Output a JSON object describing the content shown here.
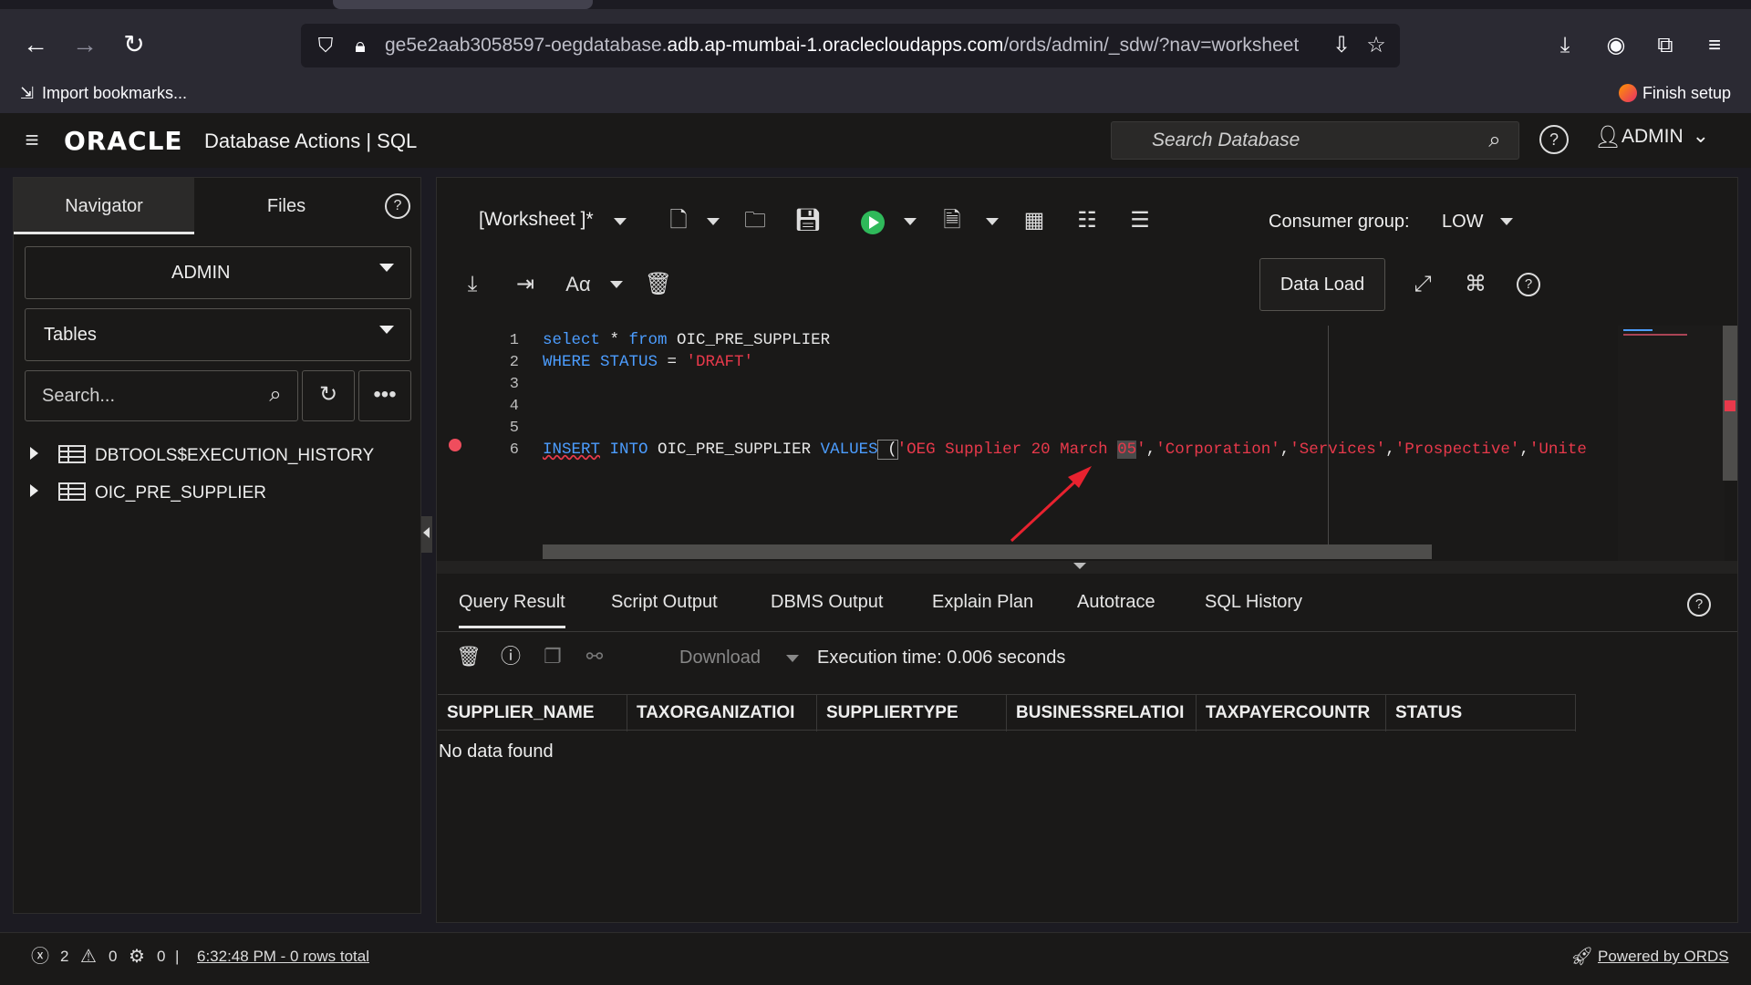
{
  "browser": {
    "url_prefix": "ge5e2aab3058597-oegdatabase.",
    "url_domain": "adb.ap-mumbai-1.oraclecloudapps.com",
    "url_path": "/ords/admin/_sdw/?nav=worksheet",
    "bookmark_import": "Import bookmarks...",
    "finish_setup": "Finish setup"
  },
  "header": {
    "logo": "ORACLE",
    "title": "Database Actions |  SQL",
    "search_placeholder": "Search Database",
    "user": "ADMIN"
  },
  "navigator": {
    "tabs": [
      "Navigator",
      "Files"
    ],
    "schema": "ADMIN",
    "object_type": "Tables",
    "search_placeholder": "Search...",
    "items": [
      {
        "label": "DBTOOLS$EXECUTION_HISTORY"
      },
      {
        "label": "OIC_PRE_SUPPLIER"
      }
    ]
  },
  "worksheet": {
    "name": "[Worksheet ]*",
    "consumer_group_label": "Consumer group:",
    "consumer_group_value": "LOW",
    "data_load_label": "Data Load",
    "line_numbers": [
      "1",
      "2",
      "3",
      "4",
      "5",
      "6"
    ],
    "code": {
      "l1_kw1": "select",
      "l1_mid": " * ",
      "l1_kw2": "from",
      "l1_id": " OIC_PRE_SUPPLIER",
      "l2_kw": "WHERE STATUS",
      "l2_eq": " = ",
      "l2_str": "'DRAFT'",
      "l6_kw1": "INSERT",
      "l6_sp1": " ",
      "l6_kw2": "INTO",
      "l6_id": " OIC_PRE_SUPPLIER ",
      "l6_kw3": "VALUES",
      "l6_paren": " (",
      "l6_s1a": "'OEG Supplier 20 March ",
      "l6_s1b": "05",
      "l6_s1c": "'",
      "l6_c1": ",",
      "l6_s2": "'Corporation'",
      "l6_c2": ",",
      "l6_s3": "'Services'",
      "l6_c3": ",",
      "l6_s4": "'Prospective'",
      "l6_c4": ",",
      "l6_s5": "'Unite"
    }
  },
  "results": {
    "tabs": [
      "Query Result",
      "Script Output",
      "DBMS Output",
      "Explain Plan",
      "Autotrace",
      "SQL History"
    ],
    "download_label": "Download",
    "execution_time": "Execution time: 0.006 seconds",
    "columns": [
      "SUPPLIER_NAME",
      "TAXORGANIZATIOI",
      "SUPPLIERTYPE",
      "BUSINESSRELATIOI",
      "TAXPAYERCOUNTR",
      "STATUS"
    ],
    "empty_message": "No data found"
  },
  "statusbar": {
    "errors": "2",
    "warnings": "0",
    "tasks": "0",
    "separator": "|",
    "last_run": "6:32:48 PM - 0 rows total",
    "powered_by": "Powered by ORDS"
  },
  "colors": {
    "keyword": "#4c9dff",
    "string": "#e8394b",
    "run": "#2fb95a",
    "annotation_arrow": "#e8222f"
  }
}
